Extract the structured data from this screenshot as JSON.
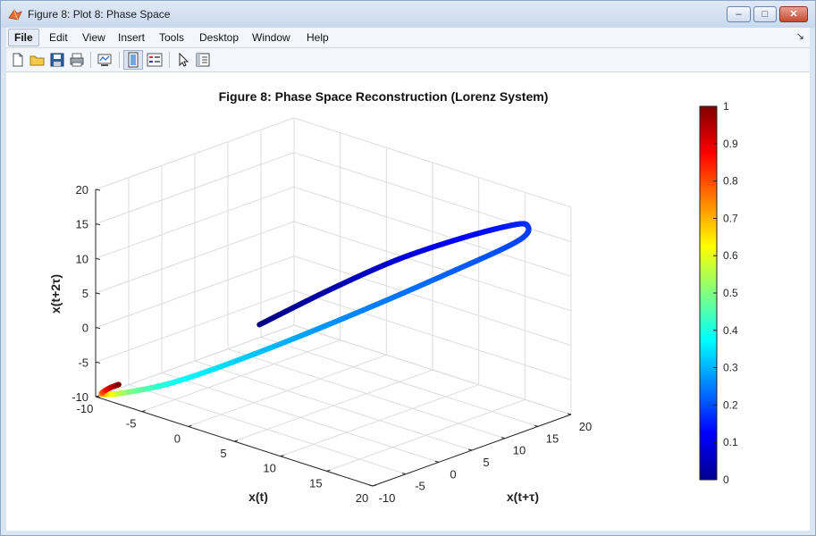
{
  "window": {
    "title": "Figure 8: Plot 8: Phase Space",
    "min_glyph": "–",
    "max_glyph": "□",
    "close_glyph": "✕"
  },
  "menu": {
    "items": [
      {
        "label": "File"
      },
      {
        "label": "Edit"
      },
      {
        "label": "View"
      },
      {
        "label": "Insert"
      },
      {
        "label": "Tools"
      },
      {
        "label": "Desktop"
      },
      {
        "label": "Window"
      },
      {
        "label": "Help"
      }
    ],
    "overflow_glyph": "↘"
  },
  "toolbar": {
    "icons": [
      "new-figure-icon",
      "open-file-icon",
      "save-icon",
      "print-icon",
      "link-plot-icon",
      "colorbar-toggle-icon",
      "legend-toggle-icon",
      "edit-plot-arrow-icon",
      "property-inspector-icon"
    ]
  },
  "chart_data": {
    "type": "line",
    "title": "Figure 8: Phase Space Reconstruction (Lorenz System)",
    "xlabel": "x(t)",
    "ylabel": "x(t+τ)",
    "zlabel": "x(t+2τ)",
    "xlim": [
      -10,
      20
    ],
    "ylim": [
      -10,
      20
    ],
    "zlim": [
      -10,
      20
    ],
    "xticks": [
      "-10",
      "-5",
      "0",
      "5",
      "10",
      "15",
      "20"
    ],
    "yticks": [
      "-10",
      "-5",
      "0",
      "5",
      "10",
      "15",
      "20"
    ],
    "zticks": [
      "-10",
      "-5",
      "0",
      "5",
      "10",
      "15",
      "20"
    ],
    "grid": true,
    "colormap": "jet",
    "colorbar": {
      "ticks": [
        "0",
        "0.1",
        "0.2",
        "0.3",
        "0.4",
        "0.5",
        "0.6",
        "0.7",
        "0.8",
        "0.9",
        "1"
      ],
      "range": [
        0,
        1
      ]
    },
    "trajectory": [
      {
        "x": 0.0,
        "y": 0.8,
        "z": 1.0,
        "c": 0.0
      },
      {
        "x": 4.0,
        "y": 5.5,
        "z": 6.0,
        "c": 0.04
      },
      {
        "x": 8.0,
        "y": 10.0,
        "z": 10.5,
        "c": 0.08
      },
      {
        "x": 12.0,
        "y": 13.5,
        "z": 14.0,
        "c": 0.12
      },
      {
        "x": 15.5,
        "y": 16.5,
        "z": 16.5,
        "c": 0.15
      },
      {
        "x": 17.0,
        "y": 17.5,
        "z": 17.0,
        "c": 0.17
      },
      {
        "x": 16.8,
        "y": 16.5,
        "z": 15.0,
        "c": 0.19
      },
      {
        "x": 12.0,
        "y": 12.0,
        "z": 9.5,
        "c": 0.22
      },
      {
        "x": 6.0,
        "y": 5.0,
        "z": 3.0,
        "c": 0.26
      },
      {
        "x": 0.0,
        "y": -1.0,
        "z": -3.0,
        "c": 0.32
      },
      {
        "x": -4.5,
        "y": -5.5,
        "z": -7.0,
        "c": 0.38
      },
      {
        "x": -8.0,
        "y": -8.0,
        "z": -9.2,
        "c": 0.5
      },
      {
        "x": -10.0,
        "y": -9.0,
        "z": -10.0,
        "c": 0.7
      },
      {
        "x": -10.0,
        "y": -8.0,
        "z": -9.5,
        "c": 0.9
      },
      {
        "x": -9.5,
        "y": -7.2,
        "z": -9.0,
        "c": 1.0
      }
    ]
  }
}
